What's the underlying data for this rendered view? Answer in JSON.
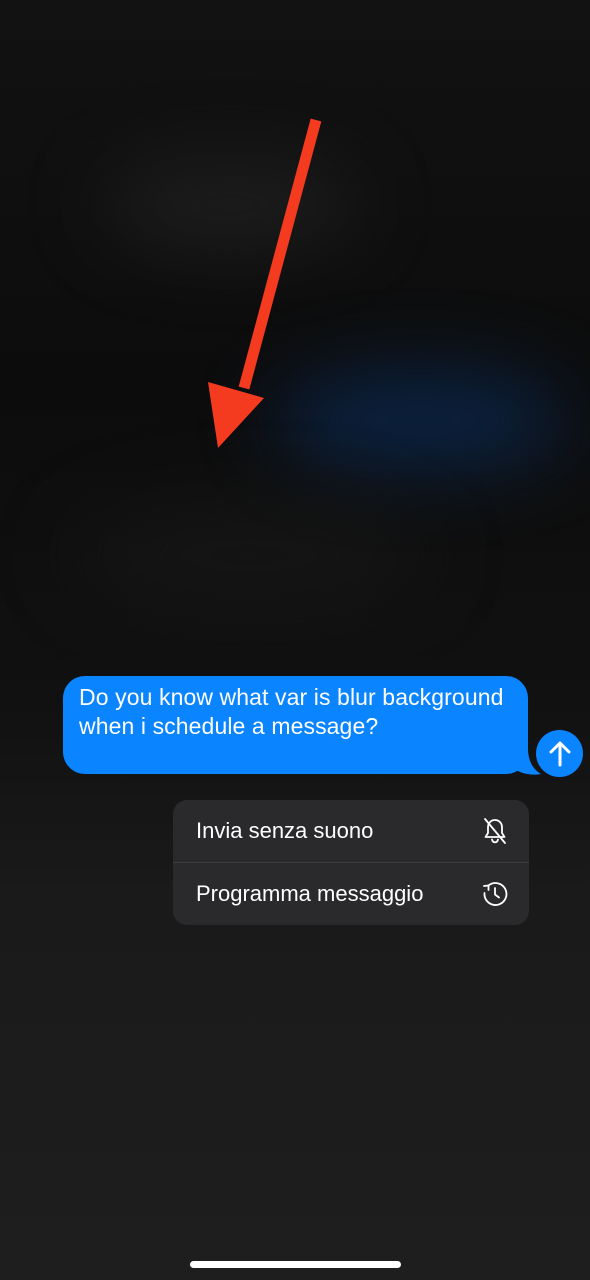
{
  "message": {
    "text": "Do you know what var is blur background when i schedule a message?",
    "bubble_color": "#0a84ff"
  },
  "send_button": {
    "icon": "arrow-up-icon"
  },
  "menu": {
    "items": [
      {
        "label": "Invia senza suono",
        "icon": "bell-slash-icon"
      },
      {
        "label": "Programma messaggio",
        "icon": "clock-arrow-icon"
      }
    ]
  },
  "annotation": {
    "arrow_color": "#f53b1f"
  },
  "colors": {
    "background": "#141414",
    "menu_background": "#2a2a2c",
    "accent": "#0a84ff"
  }
}
